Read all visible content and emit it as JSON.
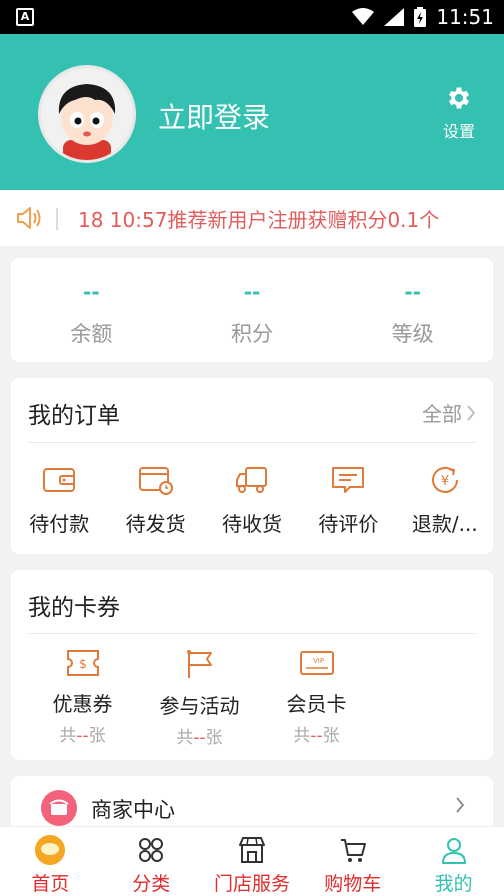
{
  "status_bar": {
    "time": "11:51",
    "left_icon_letter": "A"
  },
  "header": {
    "login_text": "立即登录",
    "settings_label": "设置"
  },
  "notice": {
    "text": "18 10:57推荐新用户注册获赠积分0.1个"
  },
  "stats": [
    {
      "value": "--",
      "label": "余额"
    },
    {
      "value": "--",
      "label": "积分"
    },
    {
      "value": "--",
      "label": "等级"
    }
  ],
  "orders": {
    "title": "我的订单",
    "more_label": "全部",
    "items": [
      {
        "label": "待付款",
        "icon": "wallet-icon"
      },
      {
        "label": "待发货",
        "icon": "card-clock-icon"
      },
      {
        "label": "待收货",
        "icon": "truck-icon"
      },
      {
        "label": "待评价",
        "icon": "comment-icon"
      },
      {
        "label": "退款/...",
        "icon": "refund-icon"
      }
    ]
  },
  "coupons": {
    "title": "我的卡券",
    "items": [
      {
        "label": "优惠券",
        "count_prefix": "共",
        "count": "--",
        "count_suffix": "张",
        "icon": "coupon-icon"
      },
      {
        "label": "参与活动",
        "count_prefix": "共",
        "count": "--",
        "count_suffix": "张",
        "icon": "flag-icon"
      },
      {
        "label": "会员卡",
        "count_prefix": "共",
        "count": "--",
        "count_suffix": "张",
        "icon": "vip-card-icon"
      }
    ]
  },
  "merchant": {
    "label": "商家中心"
  },
  "bottom_nav": [
    {
      "label": "首页",
      "icon": "home-logo-icon"
    },
    {
      "label": "分类",
      "icon": "grid-icon"
    },
    {
      "label": "门店服务",
      "icon": "store-icon"
    },
    {
      "label": "购物车",
      "icon": "cart-icon"
    },
    {
      "label": "我的",
      "icon": "user-icon",
      "active": true
    }
  ],
  "colors": {
    "primary": "#34c1b2",
    "accent_red": "#e25c5c",
    "icon_orange": "#e07a3a"
  }
}
